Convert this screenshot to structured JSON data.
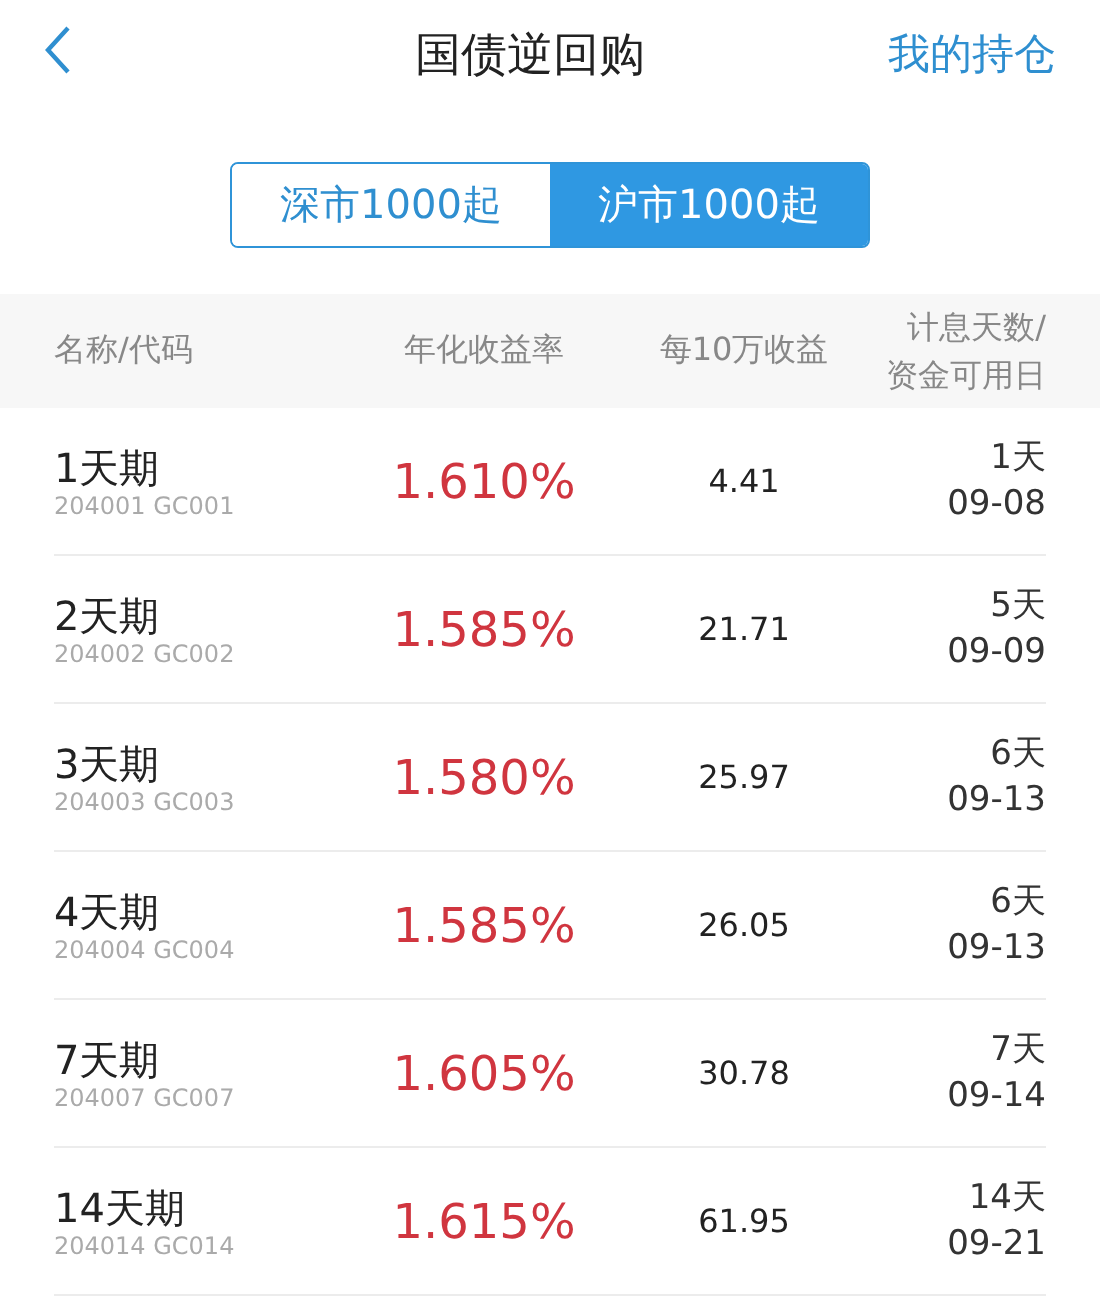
{
  "header": {
    "title": "国债逆回购",
    "action": "我的持仓"
  },
  "tabs": [
    {
      "label": "深市1000起",
      "selected": false
    },
    {
      "label": "沪市1000起",
      "selected": true
    }
  ],
  "table": {
    "columns": [
      "名称/代码",
      "年化收益率",
      "每10万收益",
      "计息天数/\n资金可用日"
    ],
    "rows": [
      {
        "name": "1天期",
        "code": "204001 GC001",
        "rate": "1.610%",
        "profit": "4.41",
        "days": "1天",
        "date": "09-08"
      },
      {
        "name": "2天期",
        "code": "204002 GC002",
        "rate": "1.585%",
        "profit": "21.71",
        "days": "5天",
        "date": "09-09"
      },
      {
        "name": "3天期",
        "code": "204003 GC003",
        "rate": "1.580%",
        "profit": "25.97",
        "days": "6天",
        "date": "09-13"
      },
      {
        "name": "4天期",
        "code": "204004 GC004",
        "rate": "1.585%",
        "profit": "26.05",
        "days": "6天",
        "date": "09-13"
      },
      {
        "name": "7天期",
        "code": "204007 GC007",
        "rate": "1.605%",
        "profit": "30.78",
        "days": "7天",
        "date": "09-14"
      },
      {
        "name": "14天期",
        "code": "204014 GC014",
        "rate": "1.615%",
        "profit": "61.95",
        "days": "14天",
        "date": "09-21"
      }
    ]
  }
}
